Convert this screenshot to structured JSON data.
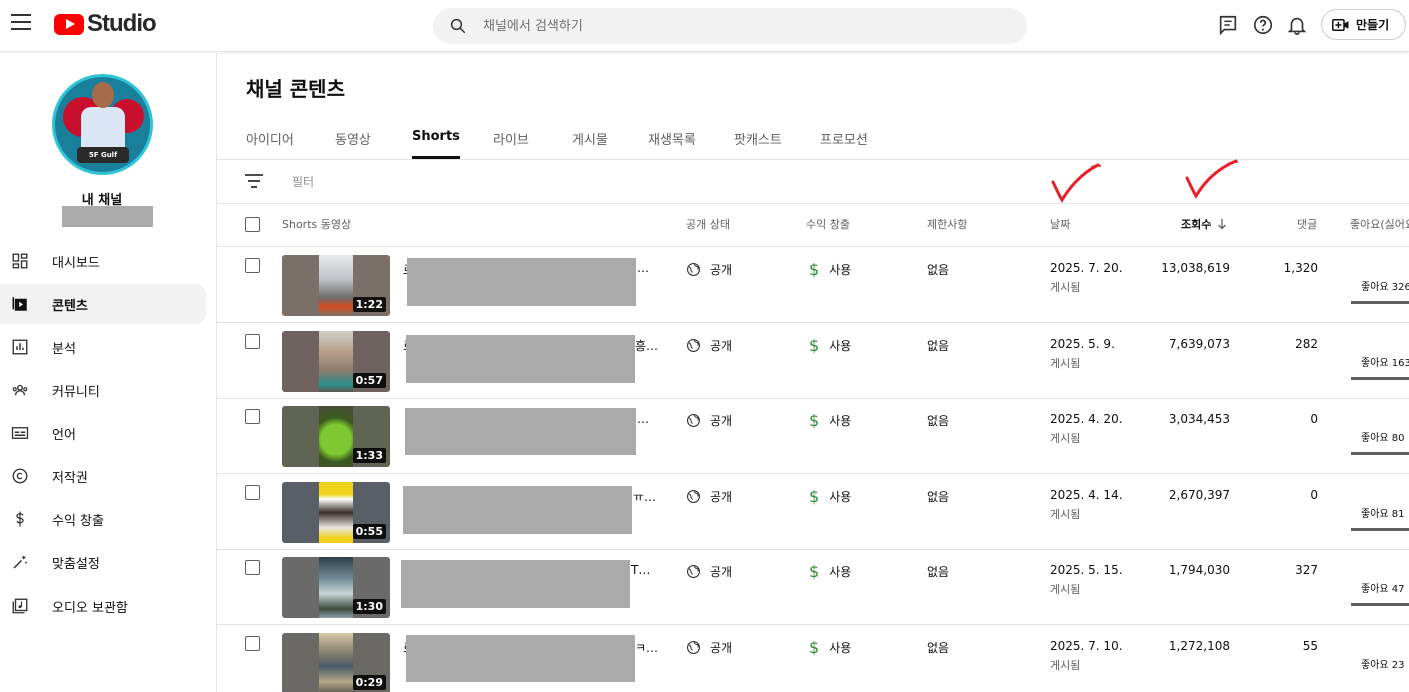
{
  "header": {
    "app_name": "Studio",
    "search_placeholder": "채널에서 검색하기",
    "create_label": "만들기"
  },
  "sidebar": {
    "channel_title": "내 채널",
    "avatar_badge": "5F Gulf",
    "items": [
      {
        "label": "대시보드",
        "icon": "dashboard-icon"
      },
      {
        "label": "콘텐츠",
        "icon": "content-icon",
        "active": true
      },
      {
        "label": "분석",
        "icon": "analytics-icon"
      },
      {
        "label": "커뮤니티",
        "icon": "community-icon"
      },
      {
        "label": "언어",
        "icon": "subtitles-icon"
      },
      {
        "label": "저작권",
        "icon": "copyright-icon"
      },
      {
        "label": "수익 창출",
        "icon": "dollar-icon"
      },
      {
        "label": "맞춤설정",
        "icon": "customization-icon"
      },
      {
        "label": "오디오 보관함",
        "icon": "audio-library-icon"
      }
    ]
  },
  "main": {
    "title": "채널 콘텐츠",
    "tabs": [
      "아이디어",
      "동영상",
      "Shorts",
      "라이브",
      "게시물",
      "재생목록",
      "팟캐스트",
      "프로모션"
    ],
    "active_tab": "Shorts",
    "filter_placeholder": "필터"
  },
  "table": {
    "columns": {
      "video": "Shorts 동영상",
      "visibility": "공개 상태",
      "monetization": "수익 창출",
      "restrictions": "제한사항",
      "date": "날짜",
      "views": "조회수",
      "comments": "댓글",
      "likes": "좋아요(싫어요"
    },
    "sorted_column": "views",
    "rows": [
      {
        "duration": "1:22",
        "title_start": "로",
        "title_end": "…",
        "visibility": "공개",
        "monetization": "사용",
        "restrictions": "없음",
        "date": "2025. 7. 20.",
        "date_status": "게시됨",
        "views": "13,038,619",
        "comments": "1,320",
        "likes": "좋아요 326"
      },
      {
        "duration": "0:57",
        "title_start": "로",
        "title_end": "흥…",
        "visibility": "공개",
        "monetization": "사용",
        "restrictions": "없음",
        "date": "2025. 5. 9.",
        "date_status": "게시됨",
        "views": "7,639,073",
        "comments": "282",
        "likes": "좋아요 163"
      },
      {
        "duration": "1:33",
        "title_start": "",
        "title_end": "…",
        "visibility": "공개",
        "monetization": "사용",
        "restrictions": "없음",
        "date": "2025. 4. 20.",
        "date_status": "게시됨",
        "views": "3,034,453",
        "comments": "0",
        "likes": "좋아요 80"
      },
      {
        "duration": "0:55",
        "title_start": "",
        "title_end": "ㅠ…",
        "visibility": "공개",
        "monetization": "사용",
        "restrictions": "없음",
        "date": "2025. 4. 14.",
        "date_status": "게시됨",
        "views": "2,670,397",
        "comments": "0",
        "likes": "좋아요 81"
      },
      {
        "duration": "1:30",
        "title_start": "",
        "title_end": "T…",
        "visibility": "공개",
        "monetization": "사용",
        "restrictions": "없음",
        "date": "2025. 5. 15.",
        "date_status": "게시됨",
        "views": "1,794,030",
        "comments": "327",
        "likes": "좋아요 47"
      },
      {
        "duration": "0:29",
        "title_start": "로",
        "title_end": "ㅋ…",
        "visibility": "공개",
        "monetization": "사용",
        "restrictions": "없음",
        "date": "2025. 7. 10.",
        "date_status": "게시됨",
        "views": "1,272,108",
        "comments": "55",
        "likes": "좋아요 23"
      }
    ]
  },
  "colors": {
    "brand_red": "#ff0000",
    "monetization_green": "#2e8b3a",
    "annotation_red": "#e8202a"
  }
}
